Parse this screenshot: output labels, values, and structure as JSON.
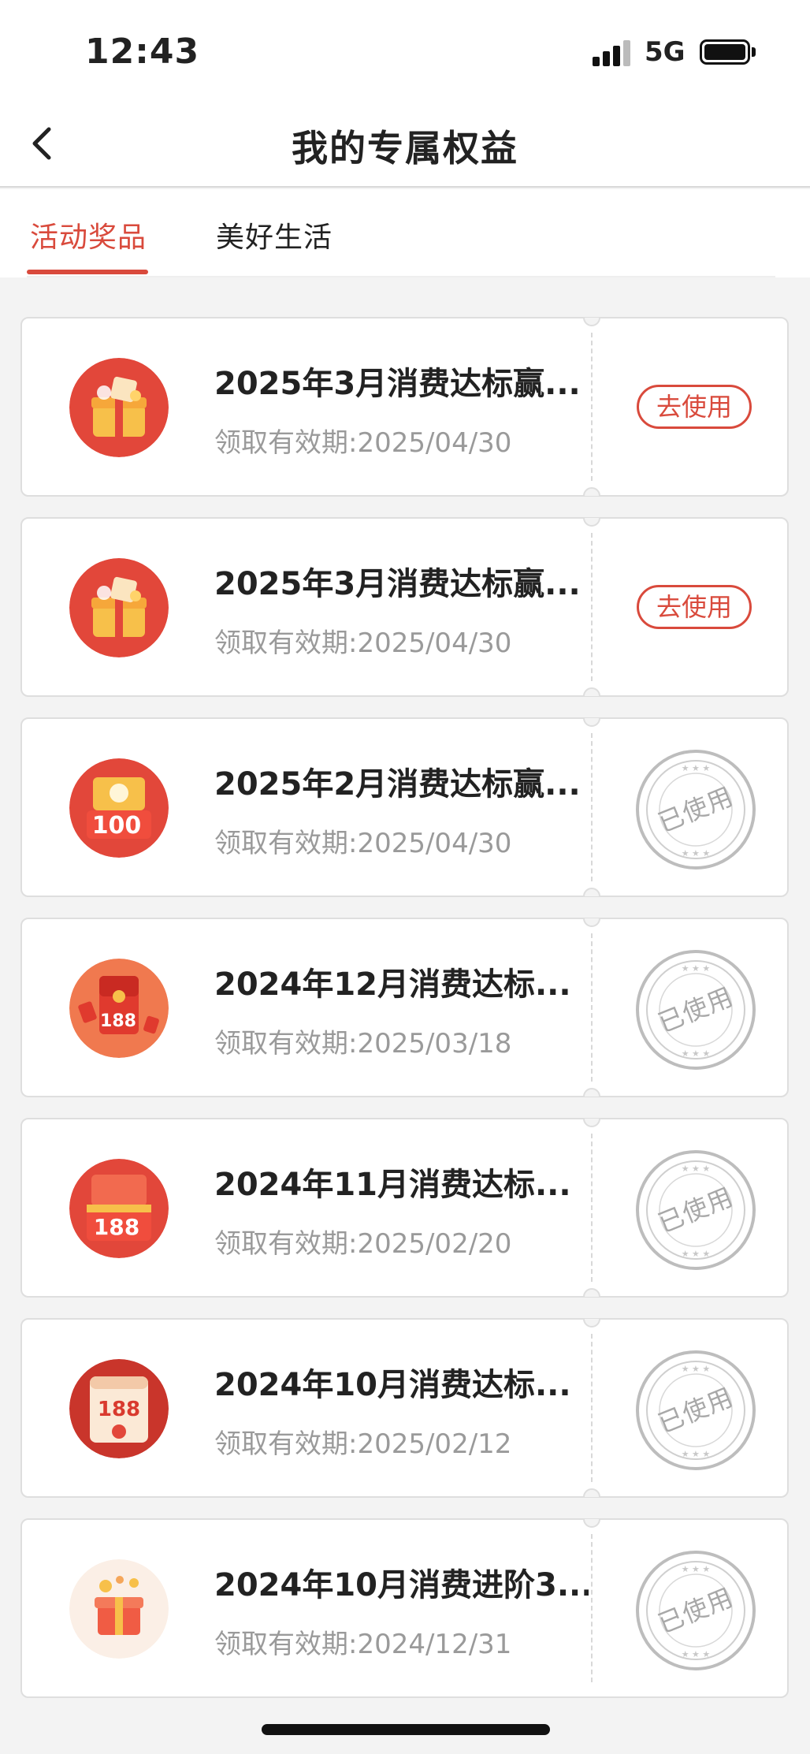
{
  "status_bar": {
    "time": "12:43",
    "network": "5G"
  },
  "header": {
    "title": "我的专属权益"
  },
  "tabs": [
    {
      "label": "活动奖品",
      "active": true
    },
    {
      "label": "美好生活",
      "active": false
    }
  ],
  "colors": {
    "accent": "#d94a3c",
    "used_stamp": "#a8a8a8"
  },
  "items": [
    {
      "title": "2025年3月消费达标赢...",
      "validity": "领取有效期:2025/04/30",
      "action": "去使用",
      "icon": "gift-box-icon"
    },
    {
      "title": "2025年3月消费达标赢...",
      "validity": "领取有效期:2025/04/30",
      "action": "去使用",
      "icon": "gift-box-icon"
    },
    {
      "title": "2025年2月消费达标赢...",
      "validity": "领取有效期:2025/04/30",
      "status": "已使用",
      "icon": "red-packet-100-icon",
      "amount": "100"
    },
    {
      "title": "2024年12月消费达标...",
      "validity": "领取有效期:2025/03/18",
      "status": "已使用",
      "icon": "red-packet-188-icon",
      "amount": "188"
    },
    {
      "title": "2024年11月消费达标...",
      "validity": "领取有效期:2025/02/20",
      "status": "已使用",
      "icon": "red-packet-box-188-icon",
      "amount": "188"
    },
    {
      "title": "2024年10月消费达标...",
      "validity": "领取有效期:2025/02/12",
      "status": "已使用",
      "icon": "red-packet-card-188-icon",
      "amount": "188"
    },
    {
      "title": "2024年10月消费进阶3...",
      "validity": "领取有效期:2024/12/31",
      "status": "已使用",
      "icon": "gift-light-icon"
    }
  ]
}
